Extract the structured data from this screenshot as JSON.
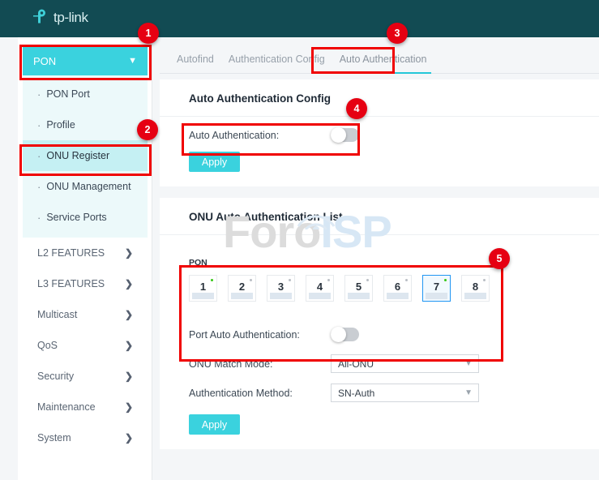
{
  "header": {
    "brand": "tp-link",
    "logo_icon": "tp-link-logo-icon"
  },
  "sidebar": {
    "group_label": "PON",
    "group_chevron": "chevron-down-icon",
    "sub_items": [
      {
        "label": "PON Port",
        "active": false
      },
      {
        "label": "Profile",
        "active": false
      },
      {
        "label": "ONU Register",
        "active": true
      },
      {
        "label": "ONU Management",
        "active": false
      },
      {
        "label": "Service Ports",
        "active": false
      }
    ],
    "groups": [
      {
        "label": "L2 FEATURES",
        "chevron": "chevron-right-icon"
      },
      {
        "label": "L3 FEATURES",
        "chevron": "chevron-right-icon"
      },
      {
        "label": "Multicast",
        "chevron": "chevron-right-icon"
      },
      {
        "label": "QoS",
        "chevron": "chevron-right-icon"
      },
      {
        "label": "Security",
        "chevron": "chevron-right-icon"
      },
      {
        "label": "Maintenance",
        "chevron": "chevron-right-icon"
      },
      {
        "label": "System",
        "chevron": "chevron-right-icon"
      }
    ]
  },
  "tabs": [
    {
      "label": "Autofind",
      "active": false
    },
    {
      "label": "Authentication Config",
      "active": false
    },
    {
      "label": "Auto Authentication",
      "active": true
    }
  ],
  "config_panel": {
    "title": "Auto Authentication Config",
    "auto_auth_label": "Auto Authentication:",
    "auto_auth_enabled": false,
    "apply_label": "Apply"
  },
  "list_panel": {
    "title": "ONU Auto Authentication List",
    "pon_header": "PON",
    "ports": [
      {
        "num": "1",
        "led": "on",
        "selected": false
      },
      {
        "num": "2",
        "led": "off",
        "selected": false
      },
      {
        "num": "3",
        "led": "off",
        "selected": false
      },
      {
        "num": "4",
        "led": "off",
        "selected": false
      },
      {
        "num": "5",
        "led": "off",
        "selected": false
      },
      {
        "num": "6",
        "led": "off",
        "selected": false
      },
      {
        "num": "7",
        "led": "on",
        "selected": true
      },
      {
        "num": "8",
        "led": "off",
        "selected": false
      }
    ],
    "port_auto_auth_label": "Port Auto Authentication:",
    "port_auto_auth_enabled": false,
    "match_mode_label": "ONU Match Mode:",
    "match_mode_value": "All-ONU",
    "auth_method_label": "Authentication Method:",
    "auth_method_value": "SN-Auth",
    "apply_label": "Apply"
  },
  "annotations": {
    "badges": [
      {
        "num": "1"
      },
      {
        "num": "2"
      },
      {
        "num": "3"
      },
      {
        "num": "4"
      },
      {
        "num": "5"
      }
    ]
  },
  "watermark": {
    "part_a": "Foro",
    "part_b": "ISP"
  },
  "colors": {
    "header_bg": "#124b53",
    "accent_cyan": "#3ad2de",
    "tab_underline": "#24c7d8",
    "selected_menu": "#c5f0f3",
    "highlight_red": "#f00000",
    "led_on": "#35c716",
    "port_selected_border": "#2196f3"
  }
}
